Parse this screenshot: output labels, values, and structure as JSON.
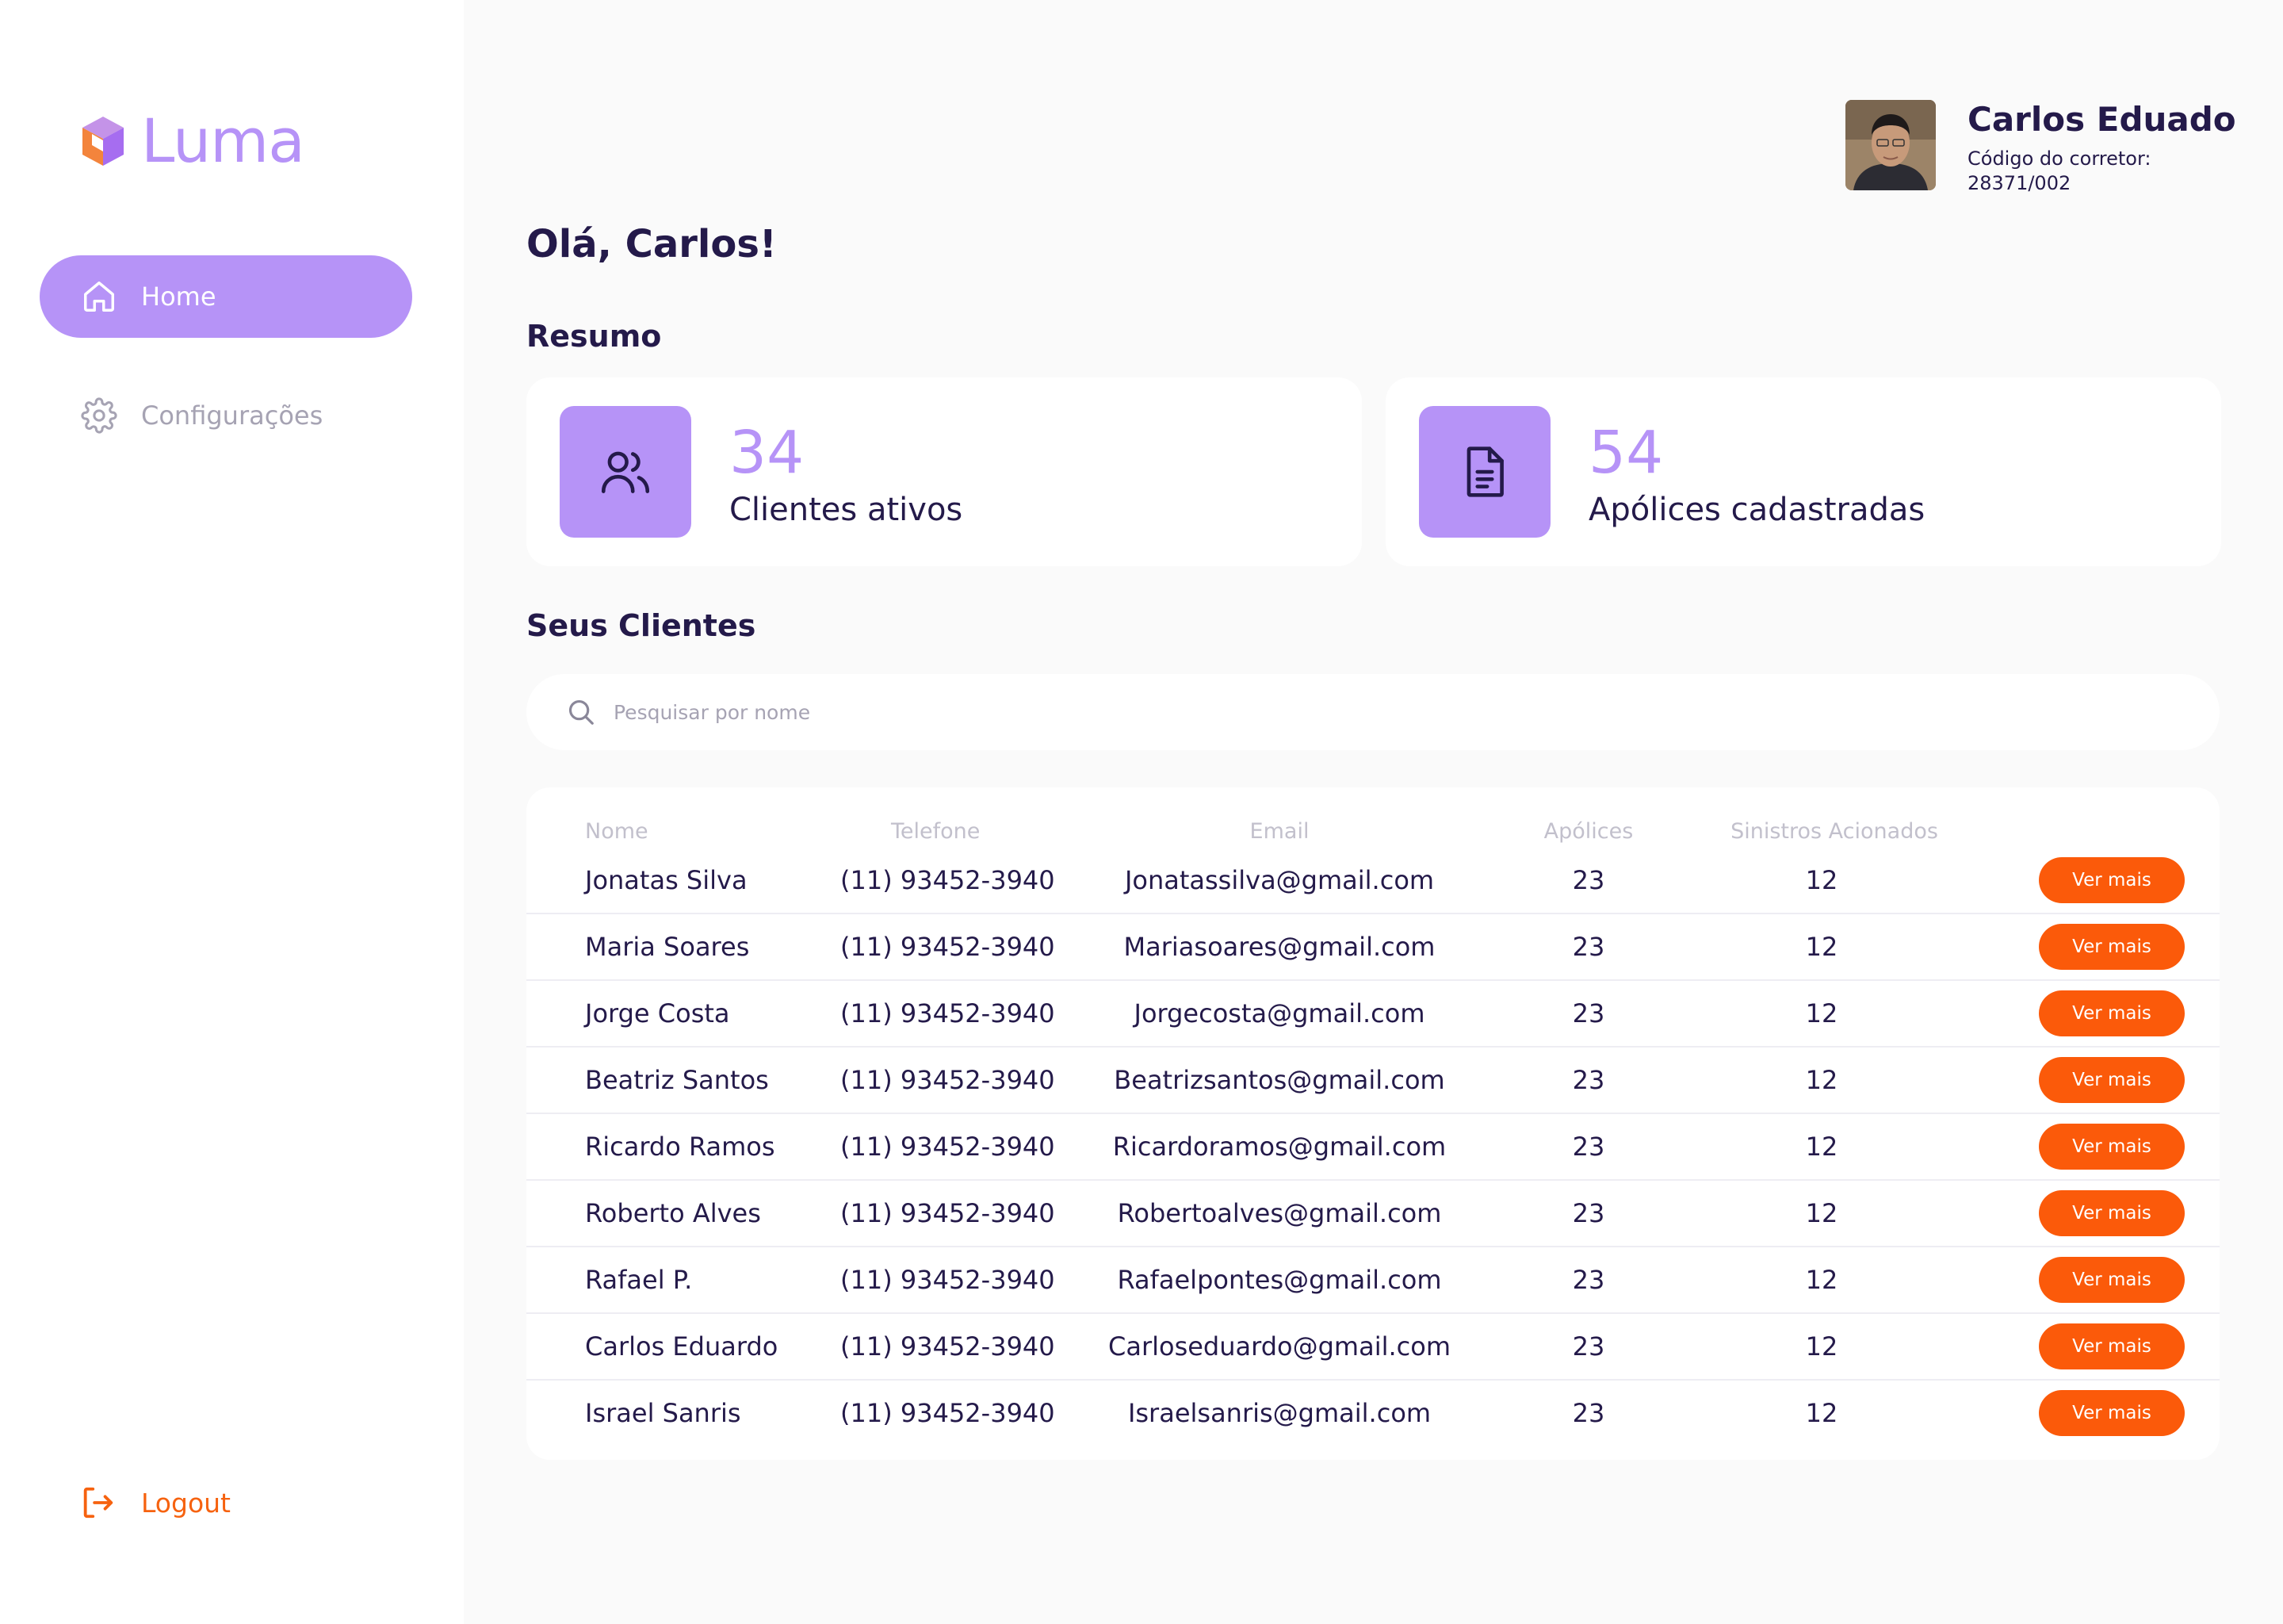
{
  "app": {
    "name": "Luma",
    "brand_color": "#b693f7",
    "accent_color": "#fb5a0a"
  },
  "sidebar": {
    "items": [
      {
        "label": "Home",
        "icon": "home-icon",
        "active": true
      },
      {
        "label": "Configurações",
        "icon": "gear-icon",
        "active": false
      }
    ],
    "logout_label": "Logout"
  },
  "user": {
    "name": "Carlos Eduado",
    "code_label": "Código do corretor:",
    "code": "28371/002"
  },
  "greeting": "Olá, Carlos!",
  "summary": {
    "title": "Resumo",
    "cards": [
      {
        "value": "34",
        "label": "Clientes ativos",
        "icon": "users-icon"
      },
      {
        "value": "54",
        "label": "Apólices cadastradas",
        "icon": "document-icon"
      }
    ]
  },
  "clients": {
    "title": "Seus Clientes",
    "search_placeholder": "Pesquisar por nome",
    "columns": [
      "Nome",
      "Telefone",
      "Email",
      "Apólices",
      "Sinistros Acionados"
    ],
    "action_label": "Ver mais",
    "rows": [
      {
        "name": "Jonatas Silva",
        "phone": "(11) 93452-3940",
        "email": "Jonatassilva@gmail.com",
        "policies": "23",
        "claims": "12"
      },
      {
        "name": "Maria Soares",
        "phone": "(11) 93452-3940",
        "email": "Mariasoares@gmail.com",
        "policies": "23",
        "claims": "12"
      },
      {
        "name": "Jorge Costa",
        "phone": "(11) 93452-3940",
        "email": "Jorgecosta@gmail.com",
        "policies": "23",
        "claims": "12"
      },
      {
        "name": "Beatriz Santos",
        "phone": "(11) 93452-3940",
        "email": "Beatrizsantos@gmail.com",
        "policies": "23",
        "claims": "12"
      },
      {
        "name": "Ricardo Ramos",
        "phone": "(11) 93452-3940",
        "email": "Ricardoramos@gmail.com",
        "policies": "23",
        "claims": "12"
      },
      {
        "name": "Roberto Alves",
        "phone": "(11) 93452-3940",
        "email": "Robertoalves@gmail.com",
        "policies": "23",
        "claims": "12"
      },
      {
        "name": "Rafael P.",
        "phone": "(11) 93452-3940",
        "email": "Rafaelpontes@gmail.com",
        "policies": "23",
        "claims": "12"
      },
      {
        "name": "Carlos Eduardo",
        "phone": "(11) 93452-3940",
        "email": "Carloseduardo@gmail.com",
        "policies": "23",
        "claims": "12"
      },
      {
        "name": "Israel Sanris",
        "phone": "(11) 93452-3940",
        "email": "Israelsanris@gmail.com",
        "policies": "23",
        "claims": "12"
      }
    ]
  }
}
